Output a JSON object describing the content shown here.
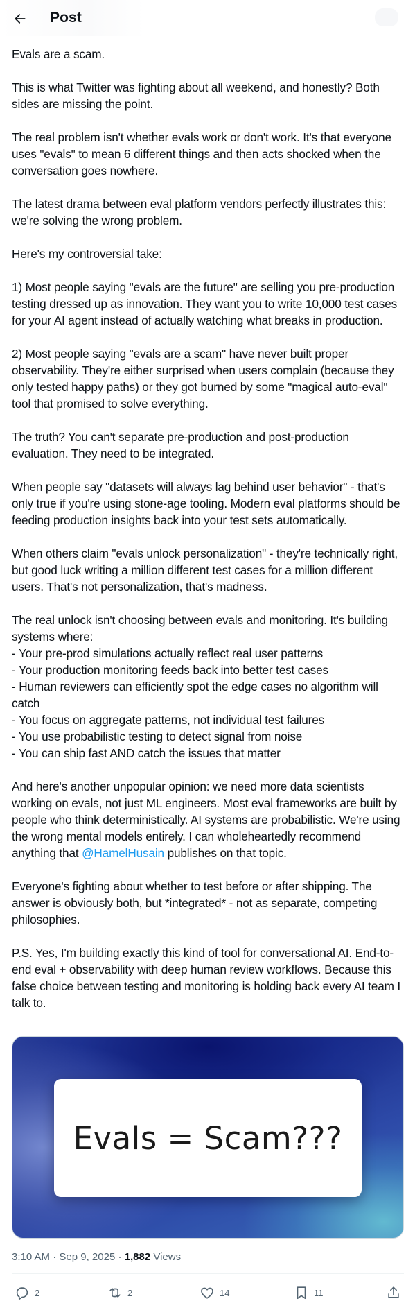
{
  "header": {
    "title": "Post"
  },
  "post": {
    "paragraphs": [
      "Evals are a scam.",
      "This is what Twitter was fighting about all weekend, and honestly? Both sides are missing the point.",
      "The real problem isn't whether evals work or don't work. It's that everyone uses \"evals\" to mean 6 different things and then acts shocked when the conversation goes nowhere.",
      "The latest drama between eval platform vendors perfectly illustrates this: we're solving the wrong problem.",
      "Here's my controversial take:",
      "1) Most people saying \"evals are the future\" are selling you pre-production testing dressed up as innovation. They want you to write 10,000 test cases for your AI agent instead of actually watching what breaks in production.",
      "2) Most people saying \"evals are a scam\" have never built proper observability. They're either surprised when users complain (because they only tested happy paths) or they got burned by some \"magical auto-eval\" tool that promised to solve everything.",
      "The truth? You can't separate pre-production and post-production evaluation. They need to be integrated.",
      "When people say \"datasets will always lag behind user behavior\" - that's only true if you're using stone-age tooling. Modern eval platforms should be feeding production insights back into your test sets automatically.",
      "When others claim \"evals unlock personalization\" - they're technically right, but good luck writing a million different test cases for a million different users. That's not personalization, that's madness."
    ],
    "systems_intro": "The real unlock isn't choosing between evals and monitoring. It's building systems where:",
    "systems_list": [
      "- Your pre-prod simulations actually reflect real user patterns",
      "- Your production monitoring feeds back into better test cases",
      "- Human reviewers can efficiently spot the edge cases no algorithm will catch",
      "- You focus on aggregate patterns, not individual test failures",
      "- You use probabilistic testing to detect signal from noise",
      "- You can ship fast AND catch the issues that matter"
    ],
    "opinion_before": "And here's another unpopular opinion: we need more data scientists working on evals, not just ML engineers. Most eval frameworks are built by people who think deterministically. AI systems are probabilistic. We're using the wrong mental models entirely. I can wholeheartedly recommend anything that ",
    "mention": "@HamelHusain",
    "opinion_after": " publishes on that topic.",
    "closing": "Everyone's fighting about whether to test before or after shipping. The answer is obviously both, but *integrated* - not as separate, competing philosophies.",
    "ps": "P.S. Yes, I'm building exactly this kind of tool for conversational AI. End-to-end eval + observability with deep human review workflows. Because this false choice between testing and monitoring is holding back every AI team I talk to."
  },
  "media": {
    "card_text": "Evals = Scam???"
  },
  "meta": {
    "time": "3:10 AM",
    "separator": " · ",
    "date": "Sep 9, 2025",
    "views_count": "1,882",
    "views_label": " Views"
  },
  "actions": {
    "replies": "2",
    "reposts": "2",
    "likes": "14",
    "bookmarks": "11"
  },
  "colors": {
    "text": "#0f1419",
    "secondary": "#536471",
    "link": "#1d9bf0"
  }
}
